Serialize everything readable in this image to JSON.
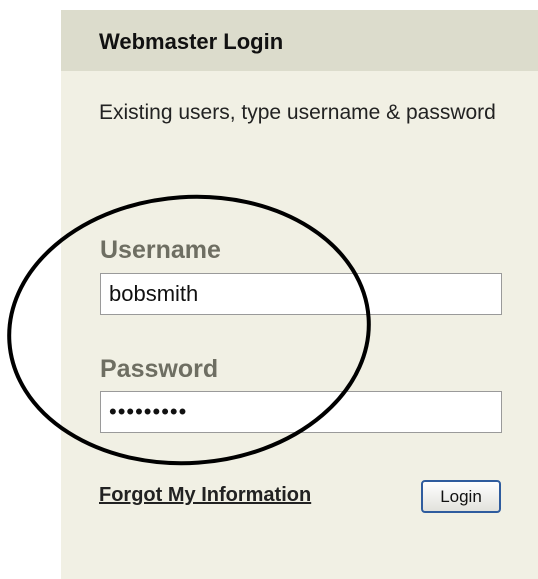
{
  "login_panel": {
    "title": "Webmaster Login",
    "intro": "Existing users, type username & password",
    "username": {
      "label": "Username",
      "value": "bobsmith"
    },
    "password": {
      "label": "Password",
      "value": "bobsmith1"
    },
    "forgot_link": "Forgot My Information",
    "login_button": "Login"
  },
  "colors": {
    "panel_background": "#f1f0e4",
    "header_background": "#dcdccc",
    "label_text": "#6e6e62",
    "button_border": "#2f5c9e",
    "annotation_stroke": "#000000"
  }
}
